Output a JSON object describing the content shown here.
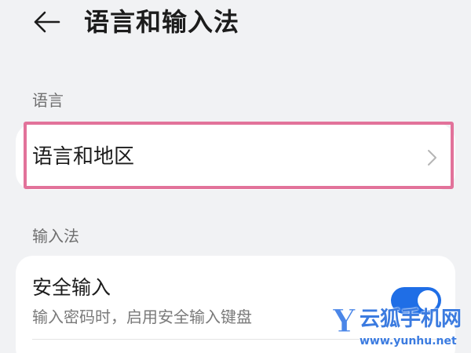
{
  "header": {
    "title": "语言和输入法",
    "back_icon": "arrow-left-icon"
  },
  "sections": {
    "language": {
      "label": "语言",
      "item_label": "语言和地区",
      "item_icon": "chevron-right-icon"
    },
    "input_method": {
      "label": "输入法",
      "secure_input": {
        "title": "安全输入",
        "subtitle": "输入密码时，启用安全输入键盘",
        "enabled": true
      }
    }
  },
  "colors": {
    "accent": "#1f6ee6",
    "highlight": "#e2729a",
    "background": "#f1f2f4"
  },
  "watermark": {
    "mark": "Y",
    "text": "云狐手机网",
    "url": "www.yunhu.net"
  }
}
